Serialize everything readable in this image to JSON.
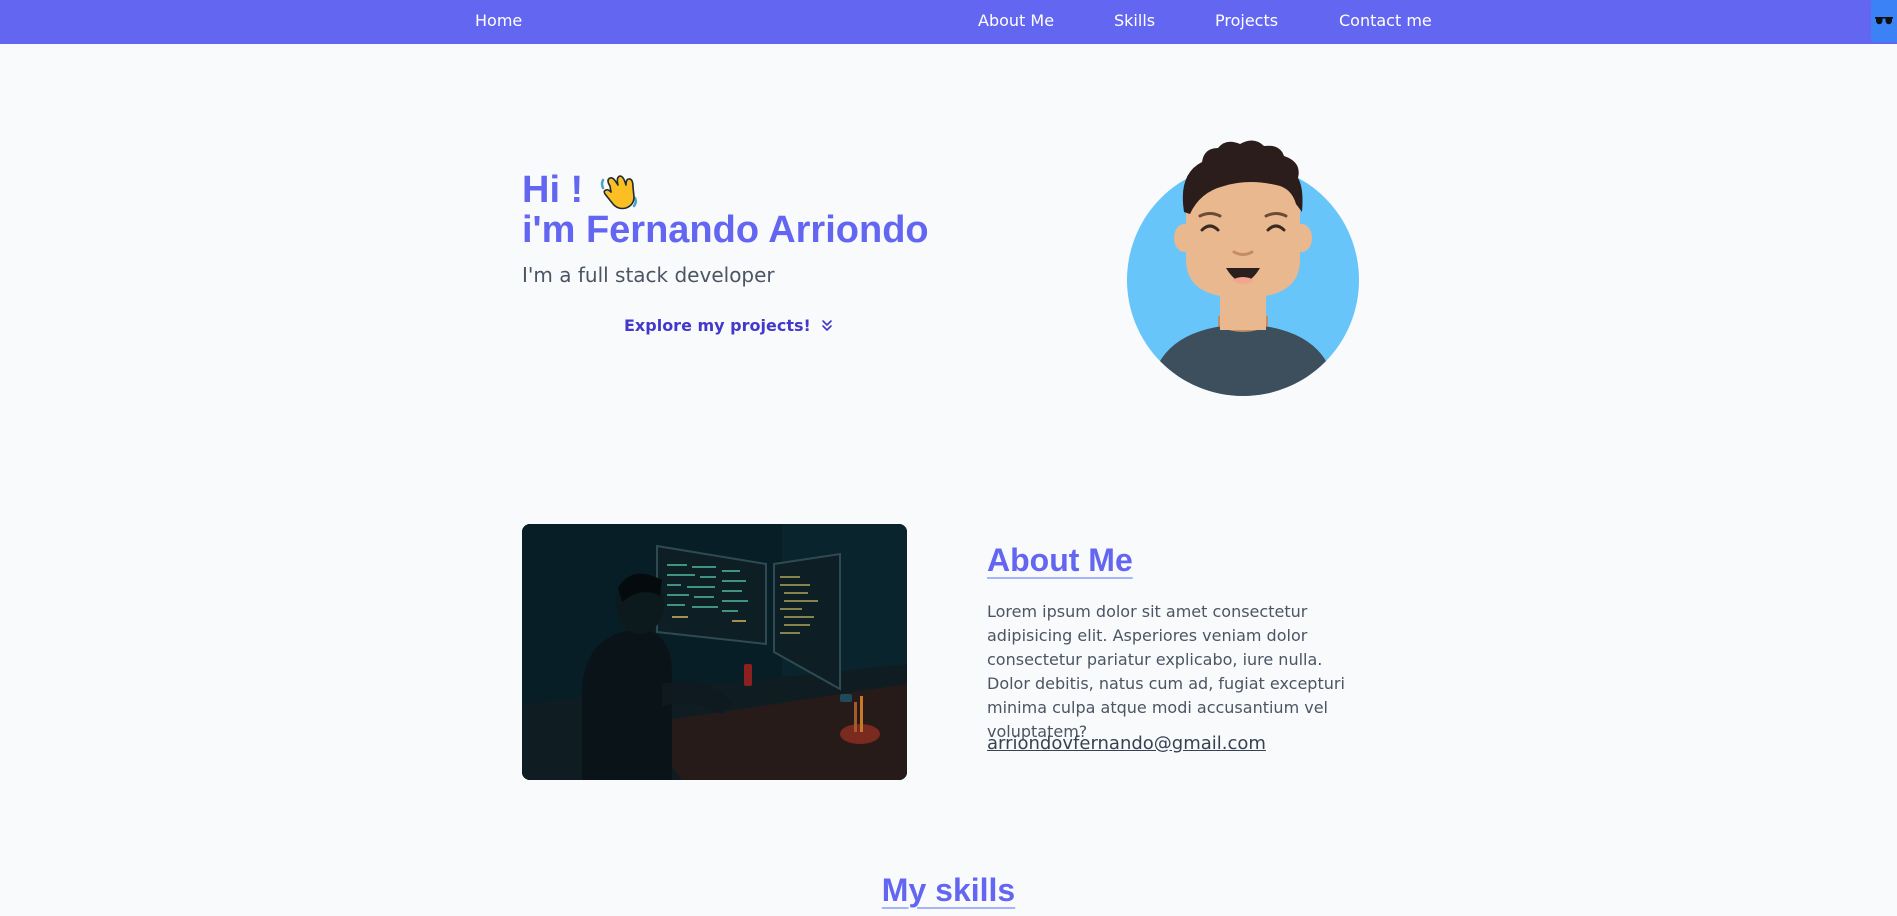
{
  "nav": {
    "home": "Home",
    "about": "About Me",
    "skills": "Skills",
    "projects": "Projects",
    "contact": "Contact me",
    "theme_icon": "sunglasses-icon"
  },
  "hero": {
    "greeting": "Hi !",
    "wave_icon": "waving-hand-icon",
    "name": "i'm Fernando Arriondo",
    "subtitle": "I'm a full stack developer",
    "explore": "Explore my projects!",
    "explore_icon": "double-chevron-down-icon",
    "avatar_icon": "smiling-man-avatar"
  },
  "about": {
    "title": "About Me",
    "text": "Lorem ipsum dolor sit amet consectetur adipisicing elit. Asperiores veniam dolor consectetur pariatur explicabo, iure nulla. Dolor debitis, natus cum ad, fugiat excepturi minima culpa atque modi accusantium vel voluptatem?",
    "email": "arriondovfernando@gmail.com"
  },
  "skills": {
    "title": "My skills"
  },
  "colors": {
    "accent": "#6366f1",
    "accent_dark": "#4338ca",
    "background": "#f8fafc",
    "text": "#4b5563",
    "toggle": "#3b82f6"
  }
}
